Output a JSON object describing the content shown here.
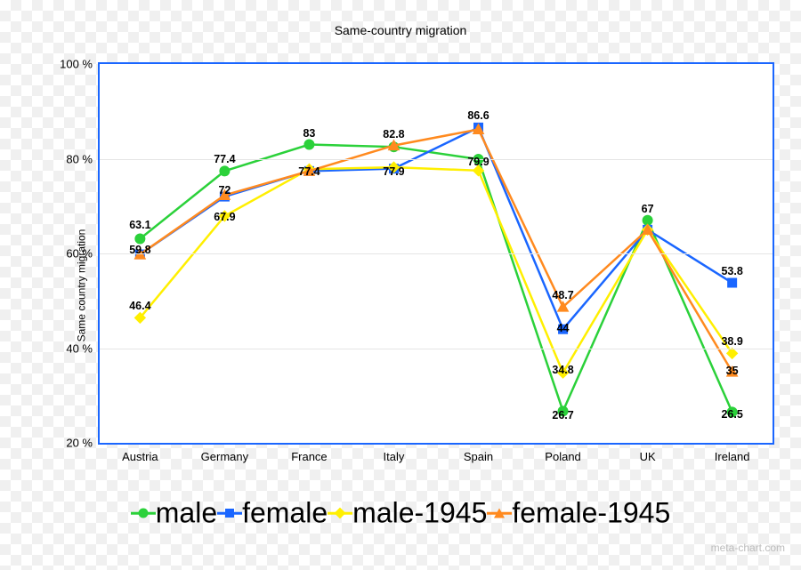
{
  "chart_data": {
    "type": "line",
    "title": "Same-country migration",
    "xlabel": "",
    "ylabel": "Same country migration",
    "ylim": [
      20,
      100
    ],
    "yticks": [
      20,
      40,
      60,
      80,
      100
    ],
    "ytick_labels": [
      "20 %",
      "40 %",
      "60 %",
      "80 %",
      "100 %"
    ],
    "categories": [
      "Austria",
      "Germany",
      "France",
      "Italy",
      "Spain",
      "Poland",
      "UK",
      "Ireland"
    ],
    "series": [
      {
        "name": "male",
        "color": "#2bd13a",
        "marker": "circle",
        "values": [
          63.1,
          77.4,
          83,
          82.5,
          79.9,
          26.7,
          67,
          26.5
        ]
      },
      {
        "name": "female",
        "color": "#1a66ff",
        "marker": "square",
        "values": [
          59.8,
          72,
          77.4,
          77.9,
          86.6,
          44,
          65,
          53.8
        ]
      },
      {
        "name": "male-1945",
        "color": "#ffef00",
        "marker": "diamond",
        "values": [
          46.4,
          67.9,
          77.8,
          78.2,
          77.5,
          34.8,
          65,
          38.9
        ]
      },
      {
        "name": "female-1945",
        "color": "#ff8a1f",
        "marker": "triangle",
        "values": [
          59.8,
          72.3,
          77.4,
          82.8,
          86.2,
          48.7,
          65,
          35
        ]
      }
    ],
    "labels": [
      {
        "text": "63.1",
        "value": 63.1,
        "cat": 0,
        "dy": -8
      },
      {
        "text": "59.8",
        "value": 59.8,
        "cat": 0,
        "dy": 2
      },
      {
        "text": "46.4",
        "value": 46.4,
        "cat": 0,
        "dy": -6
      },
      {
        "text": "77.4",
        "value": 77.4,
        "cat": 1,
        "dy": -6
      },
      {
        "text": "72",
        "value": 72,
        "cat": 1,
        "dy": 0
      },
      {
        "text": "67.9",
        "value": 67.9,
        "cat": 1,
        "dy": 8
      },
      {
        "text": "83",
        "value": 83,
        "cat": 2,
        "dy": -6
      },
      {
        "text": "77.4",
        "value": 77.4,
        "cat": 2,
        "dy": 8
      },
      {
        "text": "82.8",
        "value": 82.8,
        "cat": 3,
        "dy": -6
      },
      {
        "text": "77.9",
        "value": 77.9,
        "cat": 3,
        "dy": 10
      },
      {
        "text": "86.6",
        "value": 86.6,
        "cat": 4,
        "dy": -6
      },
      {
        "text": "79.9",
        "value": 79.9,
        "cat": 4,
        "dy": 10
      },
      {
        "text": "48.7",
        "value": 48.7,
        "cat": 5,
        "dy": -6
      },
      {
        "text": "44",
        "value": 44,
        "cat": 5,
        "dy": 6
      },
      {
        "text": "34.8",
        "value": 34.8,
        "cat": 5,
        "dy": 4
      },
      {
        "text": "26.7",
        "value": 26.7,
        "cat": 5,
        "dy": 12
      },
      {
        "text": "67",
        "value": 67,
        "cat": 6,
        "dy": -6
      },
      {
        "text": "53.8",
        "value": 53.8,
        "cat": 7,
        "dy": -6
      },
      {
        "text": "38.9",
        "value": 38.9,
        "cat": 7,
        "dy": -6
      },
      {
        "text": "35",
        "value": 35,
        "cat": 7,
        "dy": 6
      },
      {
        "text": "26.5",
        "value": 26.5,
        "cat": 7,
        "dy": 10
      }
    ]
  },
  "watermark": "meta-chart.com"
}
